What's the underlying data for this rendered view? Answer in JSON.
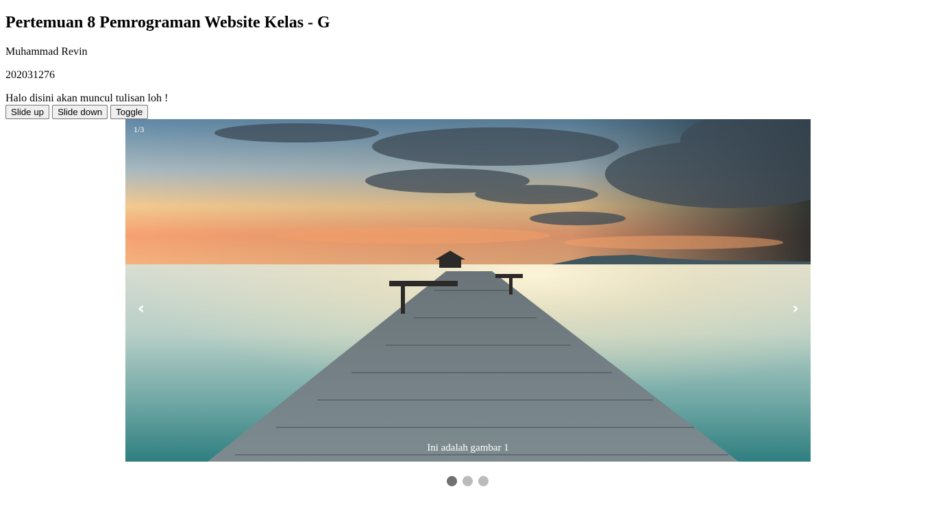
{
  "header": {
    "title": "Pertemuan 8 Pemrograman Website Kelas - G"
  },
  "student": {
    "name": "Muhammad Revin",
    "id": "202031276"
  },
  "message": "Halo disini akan muncul tulisan loh !",
  "buttons": {
    "slide_up": "Slide up",
    "slide_down": "Slide down",
    "toggle": "Toggle"
  },
  "slideshow": {
    "counter": "1/3",
    "caption": "Ini adalah gambar 1",
    "prev_icon": "‹",
    "next_icon": "›",
    "current_slide": 1,
    "total_slides": 3,
    "active_dot_color": "#717171",
    "inactive_dot_color": "#bbbbbb"
  }
}
